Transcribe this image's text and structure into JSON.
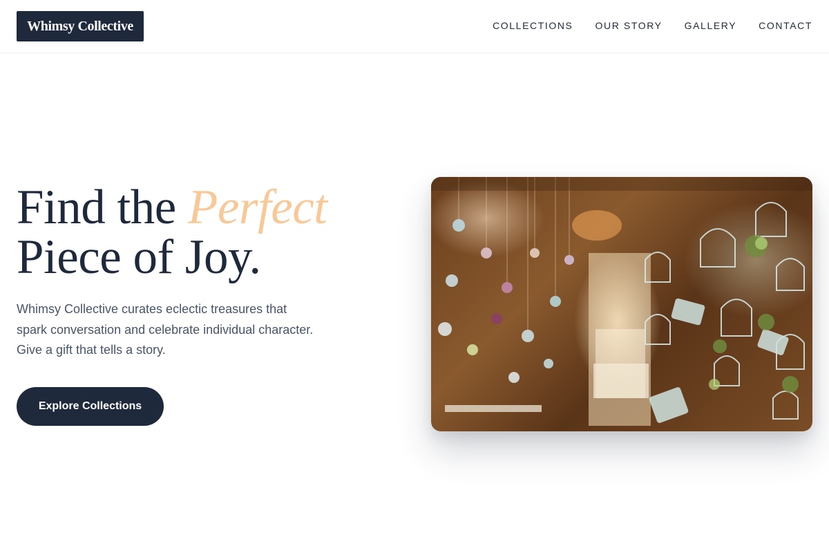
{
  "header": {
    "logo_text": "Whimsy Collective",
    "nav": [
      {
        "label": "COLLECTIONS"
      },
      {
        "label": "OUR STORY"
      },
      {
        "label": "GALLERY"
      },
      {
        "label": "CONTACT"
      }
    ]
  },
  "hero": {
    "title_part1": "Find the ",
    "title_accent": "Perfect",
    "title_line2": "Piece of Joy.",
    "description": "Whimsy Collective curates eclectic treasures that spark conversation and celebrate individual character. Give a gift that tells a story.",
    "cta_label": "Explore Collections",
    "image_alt": "Shop interior with hanging birdcages, teacups and watering cans"
  },
  "colors": {
    "primary": "#1e293b",
    "accent": "#f8c897",
    "body_text": "#475569"
  }
}
